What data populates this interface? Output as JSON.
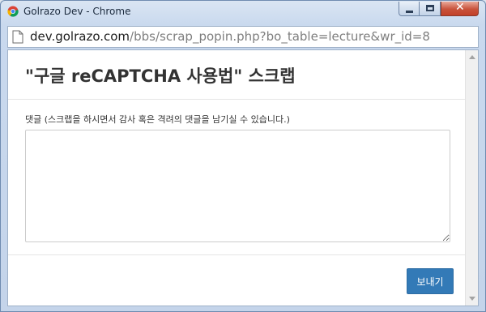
{
  "window": {
    "title": "Golrazo Dev - Chrome",
    "icon": "chrome-logo-icon"
  },
  "address": {
    "host": "dev.golrazo.com",
    "path": "/bbs/scrap_popin.php?bo_table=lecture&wr_id=8"
  },
  "modal": {
    "title": "\"구글 reCAPTCHA 사용법\" 스크랩",
    "comment_label": "댓글 (스크랩을 하시면서 감사 혹은 격려의 댓글을 남기실 수 있습니다.)",
    "comment_value": "",
    "send_label": "보내기"
  },
  "colors": {
    "primary_button": "#337ab7",
    "close_button": "#c8523b"
  }
}
